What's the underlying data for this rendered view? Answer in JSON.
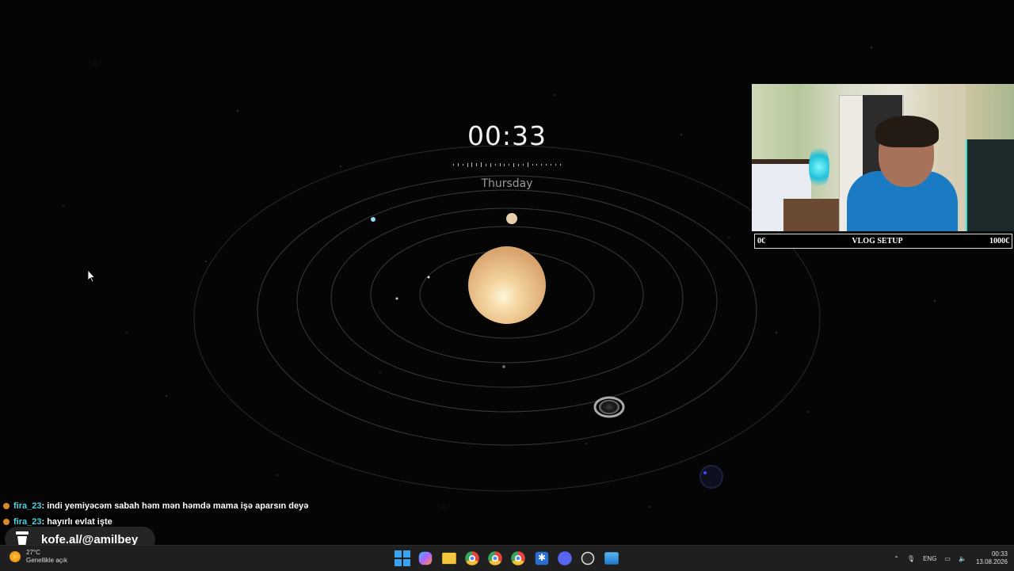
{
  "overlay": {
    "time": "00:33",
    "day": "Thursday"
  },
  "webcam": {
    "bar_left": "0€",
    "bar_title": "VLOG SETUP",
    "bar_right": "1000€"
  },
  "chat": {
    "messages": [
      {
        "user": "fira_23",
        "text": " : indi yemiyəcəm sabah həm mən həmdə mama işə aparsın deyə"
      },
      {
        "user": "fira_23",
        "text": " : hayırlı evlat işte"
      }
    ]
  },
  "donation": {
    "label": "kofe.al/@amilbey"
  },
  "taskbar": {
    "weather_temp": "27°C",
    "weather_desc": "Genellikle açık",
    "apps": [
      "start-icon",
      "copilot-icon",
      "file-explorer-icon",
      "chrome-icon",
      "chrome-icon",
      "chrome-icon",
      "snow-icon",
      "discord-icon",
      "obs-icon",
      "photos-icon"
    ],
    "language": "ENG",
    "clock_time": "00:33",
    "clock_date": "13.08.2026"
  },
  "colors": {
    "background": "#050505",
    "chat_user": "#4fd3e0",
    "taskbar": "#1f1f1f"
  }
}
